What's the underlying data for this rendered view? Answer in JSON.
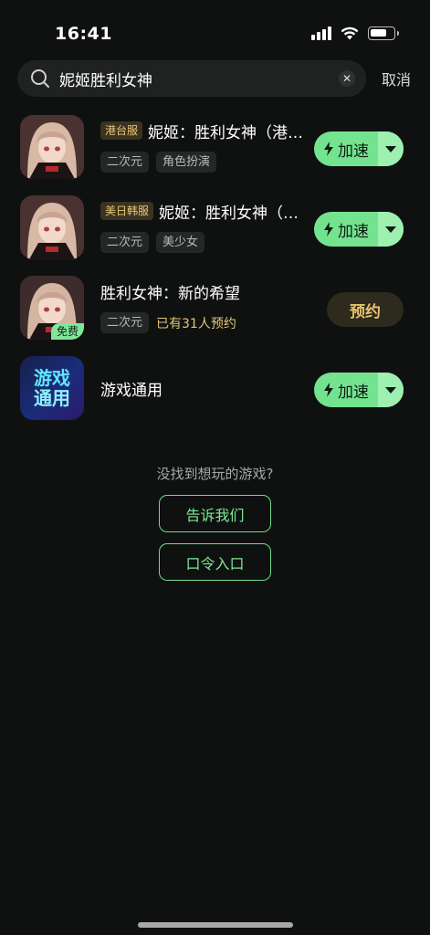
{
  "status_bar": {
    "time": "16:41"
  },
  "search": {
    "query": "妮姬胜利女神",
    "cancel_label": "取消"
  },
  "games": [
    {
      "region": "港台服",
      "title": "妮姬：胜利女神（港…",
      "tags": [
        "二次元",
        "角色扮演"
      ],
      "action": "加速"
    },
    {
      "region": "美日韩服",
      "title": "妮姬：胜利女神（…",
      "tags": [
        "二次元",
        "美少女"
      ],
      "action": "加速"
    },
    {
      "title": "胜利女神：新的希望",
      "tags": [
        "二次元"
      ],
      "reserve_count": "已有31人预约",
      "free_badge": "免费",
      "action": "预约"
    },
    {
      "title": "游戏通用",
      "icon_text_1": "游戏",
      "icon_text_2": "通用",
      "action": "加速"
    }
  ],
  "footer": {
    "prompt": "没找到想玩的游戏?",
    "tell_us_label": "告诉我们",
    "code_entry_label": "口令入口"
  },
  "colors": {
    "accent": "#74e38f",
    "gold": "#e6c36c",
    "background": "#0f1110"
  }
}
